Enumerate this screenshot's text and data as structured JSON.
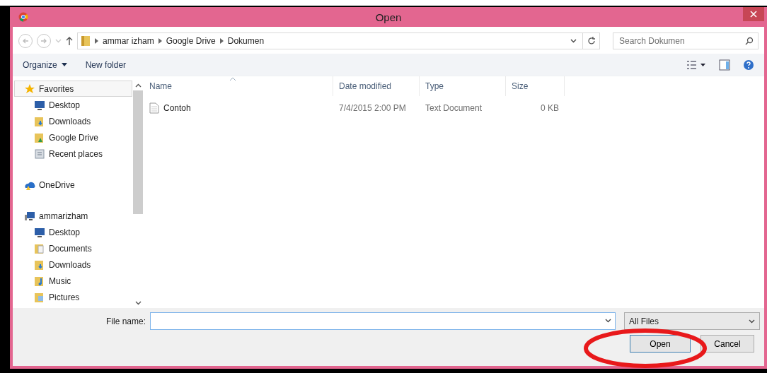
{
  "window": {
    "title": "Open"
  },
  "address": {
    "path": [
      "ammar izham",
      "Google Drive",
      "Dokumen"
    ]
  },
  "search": {
    "placeholder": "Search Dokumen"
  },
  "toolbar": {
    "buttons": [
      {
        "label": "Organize",
        "dropdown": true
      },
      {
        "label": "New folder",
        "dropdown": false
      }
    ]
  },
  "sidebar": {
    "items": [
      {
        "label": "Favorites",
        "kind": "star",
        "selected": true,
        "children": [
          {
            "label": "Desktop",
            "kind": "monitor",
            "selected": false
          },
          {
            "label": "Downloads",
            "kind": "download",
            "selected": false
          },
          {
            "label": "Google Drive",
            "kind": "folder",
            "selected": false
          },
          {
            "label": "Recent places",
            "kind": "recent",
            "selected": false
          }
        ]
      },
      {
        "label": "OneDrive",
        "kind": "cloud",
        "selected": false
      },
      {
        "label": "ammarizham",
        "kind": "computer",
        "selected": false,
        "children": [
          {
            "label": "Desktop",
            "kind": "monitor",
            "selected": false
          },
          {
            "label": "Documents",
            "kind": "document",
            "selected": false
          },
          {
            "label": "Downloads",
            "kind": "download",
            "selected": false
          },
          {
            "label": "Music",
            "kind": "music",
            "selected": false
          },
          {
            "label": "Pictures",
            "kind": "picture",
            "selected": false
          }
        ]
      }
    ]
  },
  "table": {
    "columns": [
      "Name",
      "Date modified",
      "Type",
      "Size"
    ],
    "rows": [
      {
        "cells": [
          "Contoh",
          "7/4/2015 2:00 PM",
          "Text Document",
          "0 KB"
        ],
        "selected": false
      }
    ]
  },
  "footer": {
    "file_name_label": "File name:",
    "file_type": "All Files",
    "buttons": [
      {
        "label": "Open",
        "kind": "primary"
      },
      {
        "label": "Cancel",
        "kind": "secondary"
      }
    ]
  }
}
